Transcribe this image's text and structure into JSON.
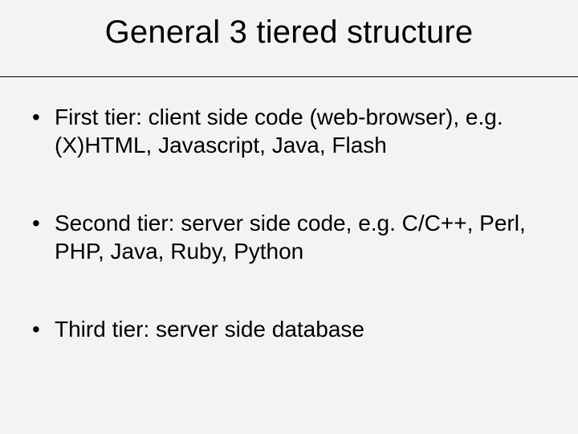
{
  "slide": {
    "title": "General 3 tiered structure",
    "bullets": [
      "First tier: client side code (web-browser), e.g. (X)HTML, Javascript, Java, Flash",
      "Second tier: server side code, e.g. C/C++, Perl, PHP, Java, Ruby, Python",
      "Third tier: server side database"
    ]
  }
}
